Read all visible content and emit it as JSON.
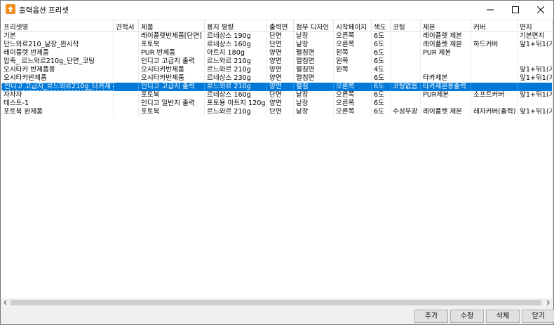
{
  "window": {
    "title": "출력옵션 프리셋"
  },
  "columns": [
    "프리셋명",
    "견적서",
    "제품",
    "용지 평량",
    "출력면",
    "첨부 디자인",
    "시작페이지",
    "색도",
    "코팅",
    "제본",
    "커버",
    "면지"
  ],
  "rows": [
    [
      "기본",
      "",
      "레이플렛반제품[단면]",
      "르네상스 190g",
      "단면",
      "낱장",
      "오른쪽",
      "6도",
      "",
      "레이플렛 제본",
      "",
      "기본면지"
    ],
    [
      "단느와르210_낱장_왼시작",
      "",
      "포토북",
      "르네상스 160g",
      "단면",
      "낱장",
      "오른쪽",
      "6도",
      "",
      "레이플렛 제본",
      "하드커버",
      "앞1+뒤1(기"
    ],
    [
      "레이플렛 반제품",
      "",
      "PUR 반제품",
      "아트지 180g",
      "양면",
      "펼침면",
      "왼쪽",
      "6도",
      "",
      "PUR 제본",
      "",
      ""
    ],
    [
      "압축_ 르느와르210g_단면_코팅",
      "",
      "인디고 고급지 출력",
      "르느와르 210g",
      "양면",
      "펼침면",
      "왼쪽",
      "6도",
      "",
      "",
      "",
      ""
    ],
    [
      "오시타카 반제품용",
      "",
      "오시타카반제품",
      "르느와르 210g",
      "양면",
      "펼침면",
      "왼쪽",
      "4도",
      "",
      "",
      "",
      "앞1+뒤1(기"
    ],
    [
      "오시타카반제품",
      "",
      "오시타카반제품",
      "르네상스 230g",
      "양면",
      "펼침면",
      "",
      "6도",
      "",
      "타카제본",
      "",
      "앞1+뒤1(기"
    ],
    [
      "인디고 고급지_르느와르210g_타카제",
      "",
      "인디고 고급지 출력",
      "르느와르 210g",
      "양면",
      "펼침",
      "오른쪽",
      "6도",
      "코팅없음",
      "타카제본용출력",
      "",
      ""
    ],
    [
      "자자자",
      "",
      "포토북",
      "르네상스 160g",
      "단면",
      "낱장",
      "오른쪽",
      "6도",
      "",
      "PUR제본",
      "소프트커버",
      "앞1+뒤1(기"
    ],
    [
      "테스트-1",
      "",
      "인디고 일반지 출력",
      "포토용 아트지 120g",
      "양면",
      "낱장",
      "오른쪽",
      "6도",
      "",
      "",
      "",
      ""
    ],
    [
      "포토북 완제품",
      "",
      "포토북",
      "르느와르 210g",
      "단면",
      "낱장",
      "오른쪽",
      "6도",
      "수성무광",
      "레이플렛 제본",
      "레자커버(출력)",
      "앞1+뒤1(기"
    ]
  ],
  "selected_row_index": 6,
  "buttons": {
    "add": "추가",
    "edit": "수정",
    "delete": "삭제",
    "close": "닫기"
  },
  "icons": {
    "app": "app-icon",
    "minimize": "minimize-icon",
    "maximize": "maximize-icon",
    "close": "close-icon"
  }
}
